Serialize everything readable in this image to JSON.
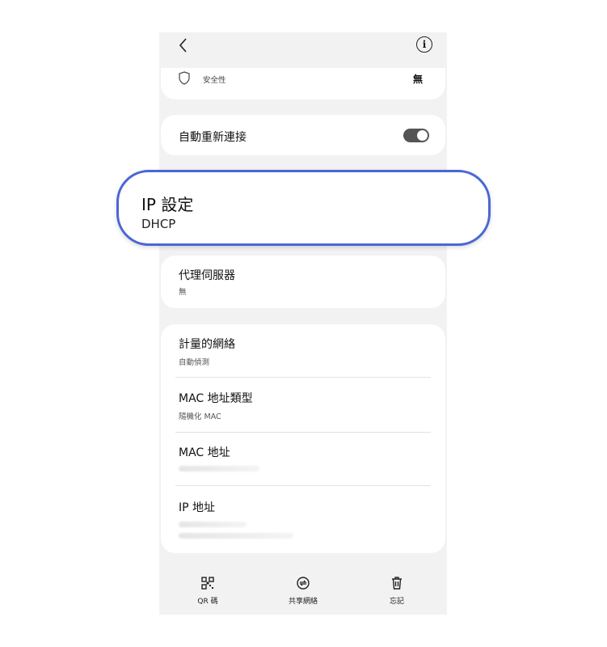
{
  "header": {
    "back_icon": "chevron-left-icon",
    "info_icon": "info-icon"
  },
  "security": {
    "label": "安全性",
    "value": "無"
  },
  "auto_reconnect": {
    "label": "自動重新連接",
    "enabled": true
  },
  "ip_settings": {
    "label": "IP 設定",
    "value": "DHCP"
  },
  "proxy": {
    "label": "代理伺服器",
    "value": "無"
  },
  "metered": {
    "label": "計量的網絡",
    "value": "自動偵測"
  },
  "mac_type": {
    "label": "MAC 地址類型",
    "value": "隨機化 MAC"
  },
  "mac_address": {
    "label": "MAC 地址"
  },
  "ip_address": {
    "label": "IP 地址"
  },
  "bottom_bar": [
    {
      "label": "QR 碼",
      "icon": "qr-code-icon"
    },
    {
      "label": "共享網絡",
      "icon": "share-network-icon"
    },
    {
      "label": "忘記",
      "icon": "trash-icon"
    }
  ],
  "colors": {
    "highlight_border": "#4a67d6",
    "toggle_on": "#555555",
    "background": "#f2f2f2"
  }
}
